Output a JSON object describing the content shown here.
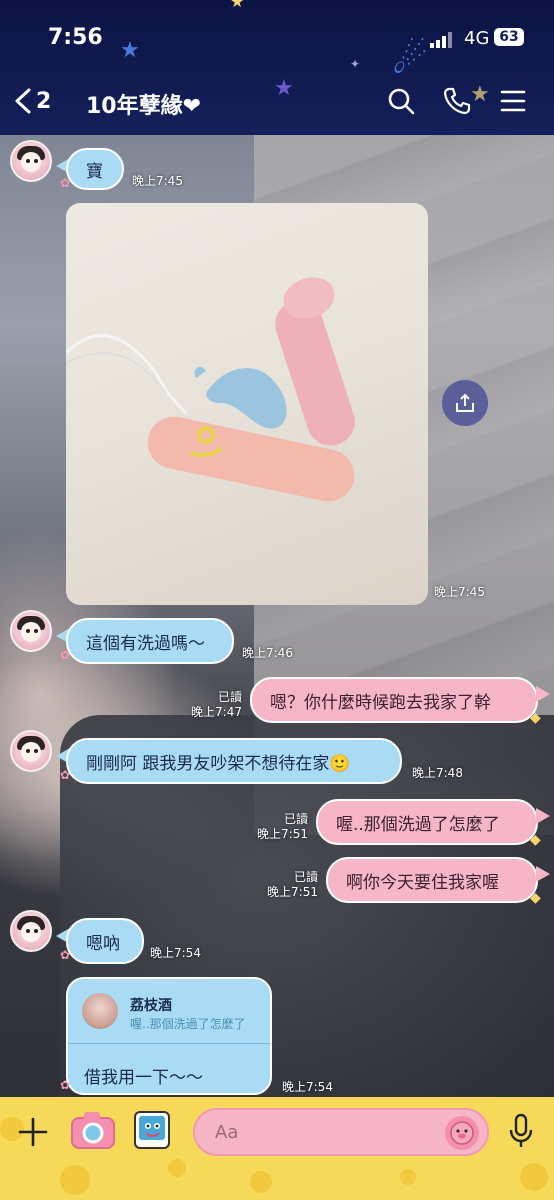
{
  "status": {
    "time": "7:56",
    "network": "4G",
    "battery": "63"
  },
  "header": {
    "back_count": "2",
    "title": "10年孽緣❤"
  },
  "messages": [
    {
      "text": "寶",
      "time": "晚上7:45"
    },
    {
      "photo_time": "晚上7:45"
    },
    {
      "text": "這個有洗過嗎～",
      "time": "晚上7:46"
    },
    {
      "text": "嗯？你什麼時候跑去我家了幹",
      "read": "已讀",
      "time": "晚上7:47"
    },
    {
      "text": "剛剛阿 跟我男友吵架不想待在家🙂",
      "time": "晚上7:48"
    },
    {
      "text": "喔..那個洗過了怎麼了",
      "read": "已讀",
      "time": "晚上7:51"
    },
    {
      "text": "啊你今天要住我家喔",
      "read": "已讀",
      "time": "晚上7:51"
    },
    {
      "text": "嗯吶",
      "time": "晚上7:54"
    }
  ],
  "reply": {
    "name": "荔枝酒",
    "quote": "喔..那個洗過了怎麼了",
    "text": "借我用一下～～",
    "time": "晚上7:54"
  },
  "input": {
    "placeholder": "Aa"
  },
  "icons": [
    "back-icon",
    "search-icon",
    "phone-icon",
    "menu-icon",
    "share-icon",
    "plus-icon",
    "camera-icon",
    "image-icon",
    "sticker-icon",
    "mic-icon"
  ]
}
